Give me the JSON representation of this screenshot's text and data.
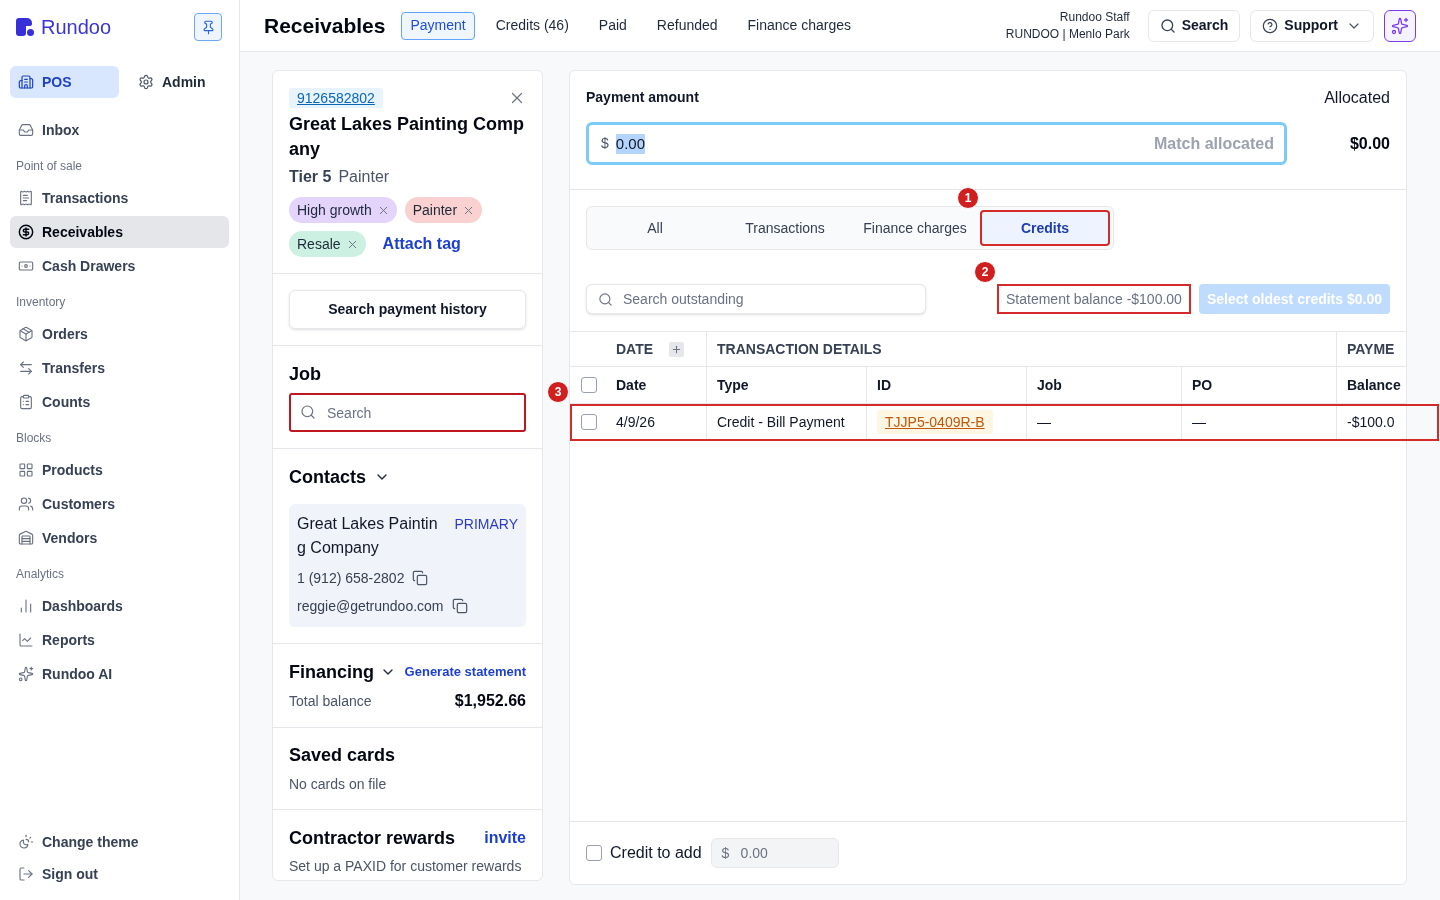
{
  "sidebar": {
    "brand": "Rundoo",
    "modes": [
      {
        "label": "POS",
        "selected": true
      },
      {
        "label": "Admin",
        "selected": false
      }
    ],
    "groups": [
      {
        "items": [
          {
            "label": "Inbox",
            "selected": false
          }
        ]
      },
      {
        "title": "Point of sale",
        "items": [
          {
            "label": "Transactions",
            "selected": false
          },
          {
            "label": "Receivables",
            "selected": true
          },
          {
            "label": "Cash Drawers",
            "selected": false
          }
        ]
      },
      {
        "title": "Inventory",
        "items": [
          {
            "label": "Orders",
            "selected": false
          },
          {
            "label": "Transfers",
            "selected": false
          },
          {
            "label": "Counts",
            "selected": false
          }
        ]
      },
      {
        "title": "Blocks",
        "items": [
          {
            "label": "Products",
            "selected": false
          },
          {
            "label": "Customers",
            "selected": false
          },
          {
            "label": "Vendors",
            "selected": false
          }
        ]
      },
      {
        "title": "Analytics",
        "items": [
          {
            "label": "Dashboards",
            "selected": false
          },
          {
            "label": "Reports",
            "selected": false
          },
          {
            "label": "Rundoo AI",
            "selected": false
          }
        ]
      }
    ],
    "footer_items": [
      {
        "label": "Change theme"
      },
      {
        "label": "Sign out"
      }
    ]
  },
  "header": {
    "title": "Receivables",
    "tabs": [
      {
        "label": "Payment",
        "selected": true
      },
      {
        "label": "Credits (46)",
        "selected": false
      },
      {
        "label": "Paid",
        "selected": false
      },
      {
        "label": "Refunded",
        "selected": false
      },
      {
        "label": "Finance charges",
        "selected": false
      }
    ],
    "user_name": "Rundoo Staff",
    "store": "RUNDOO | Menlo Park",
    "search_button": "Search",
    "support_button": "Support"
  },
  "customer": {
    "phone": "9126582802",
    "name": "Great Lakes Painting Company",
    "tier": "Tier 5",
    "trade": "Painter",
    "tags": [
      {
        "label": "High growth",
        "color": "#e4d4fc"
      },
      {
        "label": "Painter",
        "color": "#f9d1d0"
      },
      {
        "label": "Resale",
        "color": "#ccf1e2"
      }
    ],
    "attach_tag": "Attach tag"
  },
  "history_button": "Search payment history",
  "job": {
    "title": "Job",
    "search": {
      "placeholder": "Search",
      "highlighted": true
    }
  },
  "contacts": {
    "title": "Contacts",
    "items": [
      {
        "name": "Great Lakes Painting Company",
        "badge": "PRIMARY",
        "phone": "1 (912) 658-2802",
        "email": "reggie@getrundoo.com"
      }
    ]
  },
  "financing": {
    "title": "Financing",
    "link": "Generate statement",
    "total_label": "Total balance",
    "total": "$1,952.66"
  },
  "saved_cards": {
    "title": "Saved cards",
    "empty_text": "No cards on file"
  },
  "rewards": {
    "title": "Contractor rewards",
    "link": "invite",
    "text": "Set up a PAXID for customer rewards"
  },
  "payment": {
    "label": "Payment amount",
    "currency": "$",
    "value": "0.00",
    "value_selected": true,
    "match_button": {
      "label": "Match allocated",
      "disabled": true
    },
    "allocated_label": "Allocated",
    "allocated": "$0.00"
  },
  "filter_tabs": [
    {
      "label": "All",
      "selected": false
    },
    {
      "label": "Transactions",
      "selected": false
    },
    {
      "label": "Finance charges",
      "selected": false
    },
    {
      "label": "Credits",
      "selected": true,
      "annotation": "1"
    }
  ],
  "outstanding_search": {
    "placeholder": "Search outstanding"
  },
  "statement_balance": {
    "text": "Statement balance -$100.00",
    "annotation": "2"
  },
  "select_oldest_button": {
    "label": "Select oldest credits $0.00",
    "disabled": true
  },
  "table": {
    "groups": [
      {
        "label": "DATE"
      },
      {
        "label": "TRANSACTION DETAILS"
      },
      {
        "label": "PAYME"
      }
    ],
    "columns": [
      "Date",
      "Type",
      "ID",
      "Job",
      "PO",
      "Balance"
    ],
    "header_checked": false,
    "rows": [
      {
        "checked": false,
        "annotation": "3",
        "cells": [
          {
            "kind": "text",
            "text": "4/9/26"
          },
          {
            "kind": "text",
            "text": "Credit - Bill Payment"
          },
          {
            "kind": "link",
            "text": "TJJP5-0409R-B"
          },
          {
            "kind": "text",
            "text": "—"
          },
          {
            "kind": "text",
            "text": "—"
          },
          {
            "kind": "text",
            "text": "-$100.0"
          }
        ]
      }
    ]
  },
  "credit_to_add": {
    "label": "Credit to add",
    "checked": false,
    "currency": "$",
    "placeholder": "0.00",
    "disabled": true
  }
}
